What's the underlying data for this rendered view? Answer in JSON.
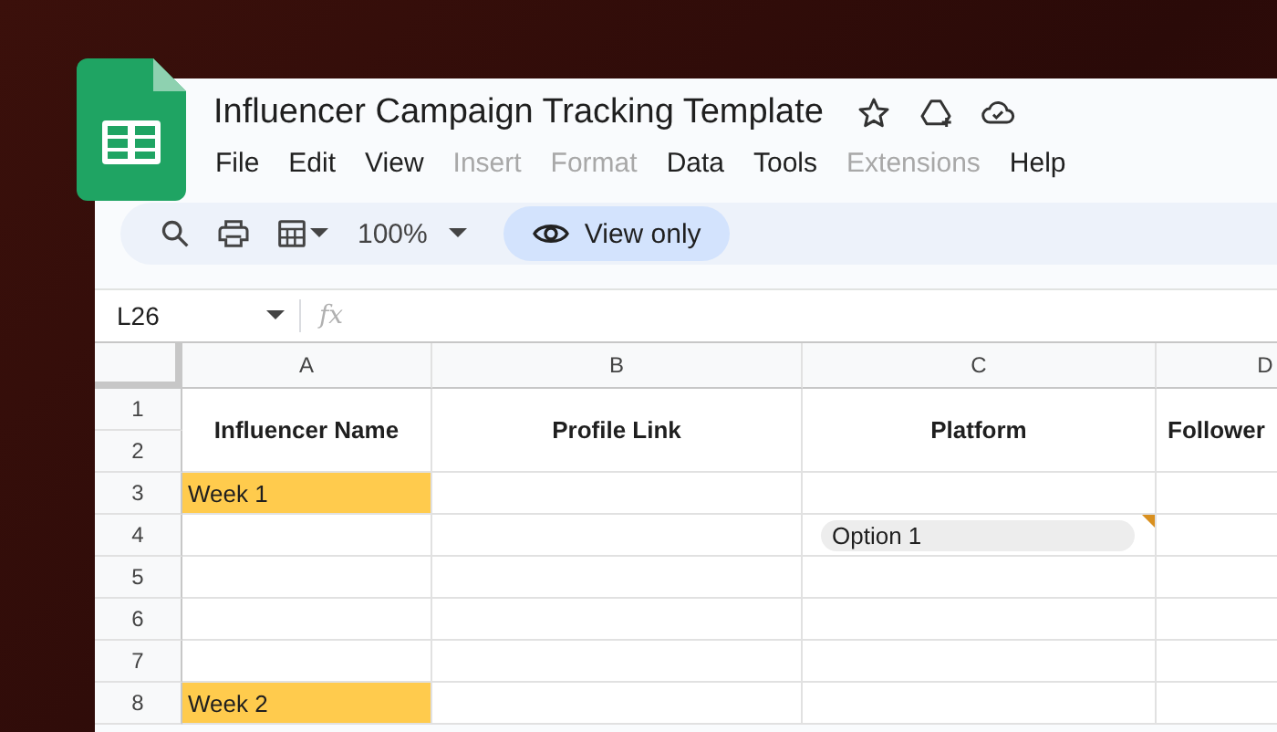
{
  "document": {
    "title": "Influencer Campaign Tracking Template"
  },
  "menu": [
    {
      "label": "File",
      "disabled": false
    },
    {
      "label": "Edit",
      "disabled": false
    },
    {
      "label": "View",
      "disabled": false
    },
    {
      "label": "Insert",
      "disabled": true
    },
    {
      "label": "Format",
      "disabled": true
    },
    {
      "label": "Data",
      "disabled": false
    },
    {
      "label": "Tools",
      "disabled": false
    },
    {
      "label": "Extensions",
      "disabled": true
    },
    {
      "label": "Help",
      "disabled": false
    }
  ],
  "toolbar": {
    "zoom": "100%",
    "mode_button": "View only"
  },
  "formula_bar": {
    "cell_reference": "L26",
    "function_symbol": "fx"
  },
  "sheet": {
    "columns": [
      "A",
      "B",
      "C",
      "D"
    ],
    "header_cells": [
      "Influencer Name",
      "Profile Link",
      "Platform",
      "Follower"
    ],
    "rows": [
      {
        "number": "1",
        "cells": []
      },
      {
        "number": "2",
        "cells": []
      },
      {
        "number": "3",
        "cells": [
          {
            "kind": "highlight",
            "text": "Week 1"
          },
          {
            "kind": "empty"
          },
          {
            "kind": "empty"
          },
          {
            "kind": "empty"
          }
        ]
      },
      {
        "number": "4",
        "cells": [
          {
            "kind": "empty"
          },
          {
            "kind": "empty"
          },
          {
            "kind": "chip",
            "text": "Option 1"
          },
          {
            "kind": "empty"
          }
        ]
      },
      {
        "number": "5",
        "cells": [
          {
            "kind": "empty"
          },
          {
            "kind": "empty"
          },
          {
            "kind": "empty"
          },
          {
            "kind": "empty"
          }
        ]
      },
      {
        "number": "6",
        "cells": [
          {
            "kind": "empty"
          },
          {
            "kind": "empty"
          },
          {
            "kind": "empty"
          },
          {
            "kind": "empty"
          }
        ]
      },
      {
        "number": "7",
        "cells": [
          {
            "kind": "empty"
          },
          {
            "kind": "empty"
          },
          {
            "kind": "empty"
          },
          {
            "kind": "empty"
          }
        ]
      },
      {
        "number": "8",
        "cells": [
          {
            "kind": "highlight",
            "text": "Week 2"
          },
          {
            "kind": "empty"
          },
          {
            "kind": "empty"
          },
          {
            "kind": "empty"
          }
        ]
      }
    ]
  }
}
